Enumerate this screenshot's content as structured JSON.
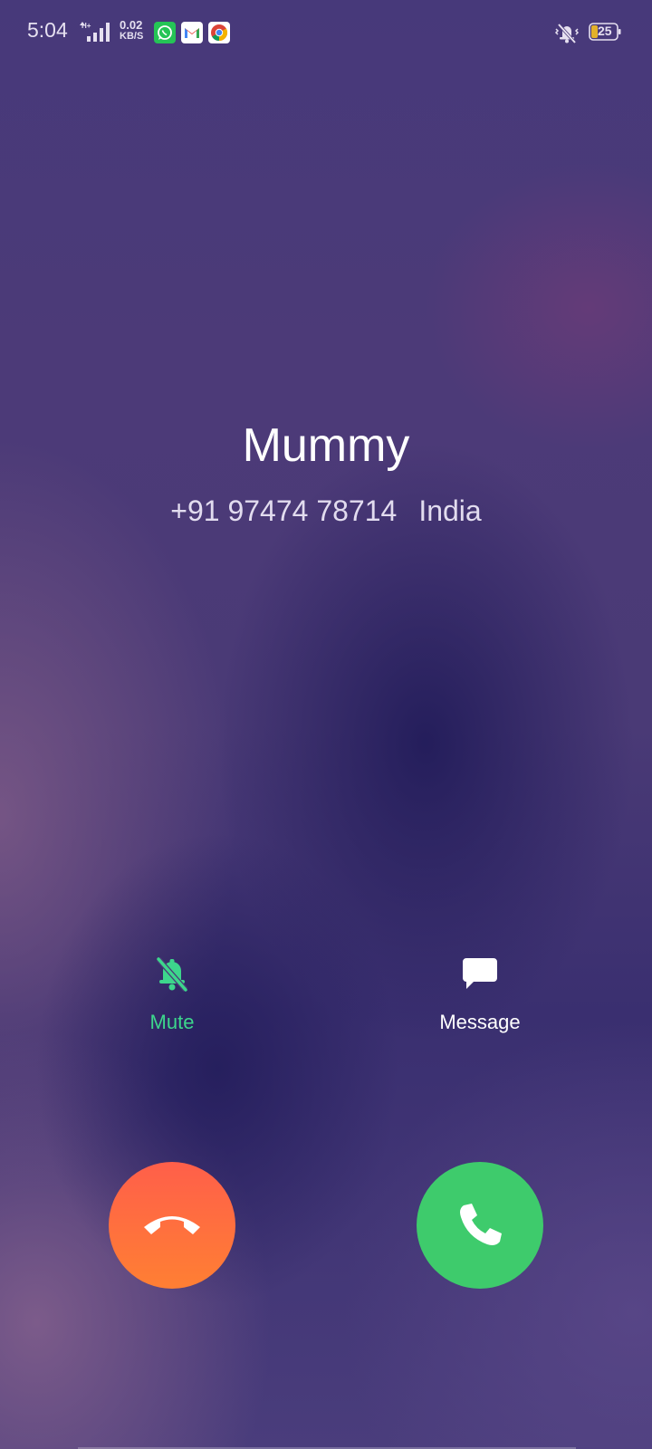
{
  "status_bar": {
    "time": "5:04",
    "network_type": "H+",
    "net_speed_value": "0.02",
    "net_speed_unit": "KB/S",
    "notification_icons": [
      "whatsapp-icon",
      "gmail-icon",
      "chrome-icon"
    ],
    "ringer_mode_icon": "vibrate-silent-icon",
    "battery_level": "25"
  },
  "caller": {
    "name": "Mummy",
    "number": "+91 97474 78714",
    "location": "India"
  },
  "actions": {
    "mute_label": "Mute",
    "message_label": "Message"
  },
  "colors": {
    "accent_green": "#3dd68c",
    "decline_top": "#ff5f4a",
    "decline_bottom": "#ff7f33",
    "answer": "#3ecb6c"
  }
}
